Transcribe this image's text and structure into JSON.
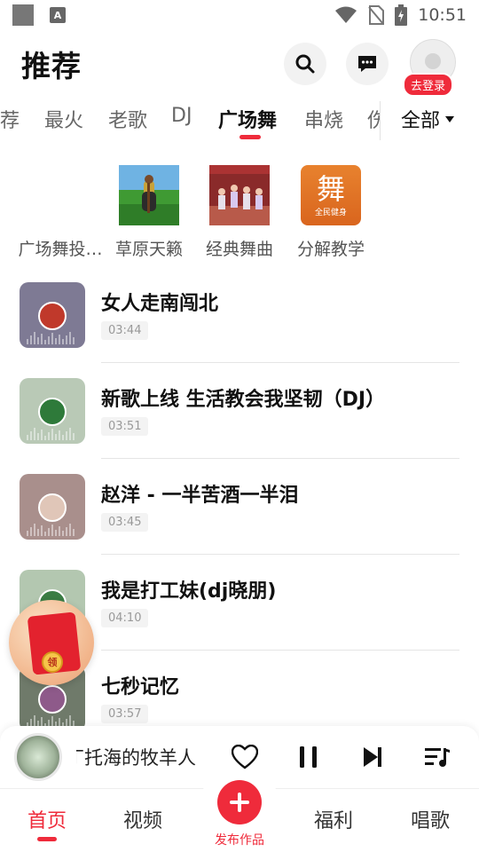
{
  "status_bar": {
    "time": "10:51",
    "notification_letter": "A"
  },
  "header": {
    "title": "推荐",
    "login_badge": "去登录"
  },
  "category_tabs": {
    "items": [
      "荐",
      "最火",
      "老歌",
      "DJ",
      "广场舞",
      "串烧",
      "伤"
    ],
    "active_label": "广场舞",
    "all_label": "全部"
  },
  "featured": [
    {
      "label": "广场舞投…"
    },
    {
      "label": "草原天籁"
    },
    {
      "label": "经典舞曲"
    },
    {
      "label": "分解教学",
      "thumb_text": "舞",
      "thumb_subtext": "全民健身"
    }
  ],
  "songs": [
    {
      "title": "女人走南闯北",
      "duration": "03:44"
    },
    {
      "title": "新歌上线 生活教会我坚韧（DJ）",
      "duration": "03:51"
    },
    {
      "title": "赵洋 - 一半苦酒一半泪",
      "duration": "03:45"
    },
    {
      "title": "我是打工妹(dj晓朋)",
      "duration": "04:10"
    },
    {
      "title": "七秒记忆",
      "duration": "03:57"
    }
  ],
  "red_packet": {
    "coin_text": "领"
  },
  "player": {
    "title": "丁托海的牧羊人",
    "state": "playing"
  },
  "bottom_nav": {
    "home": "首页",
    "video": "视频",
    "publish": "发布作品",
    "welfare": "福利",
    "sing": "唱歌"
  },
  "colors": {
    "accent": "#ef2b3b",
    "text": "#111111",
    "muted": "#999999"
  }
}
